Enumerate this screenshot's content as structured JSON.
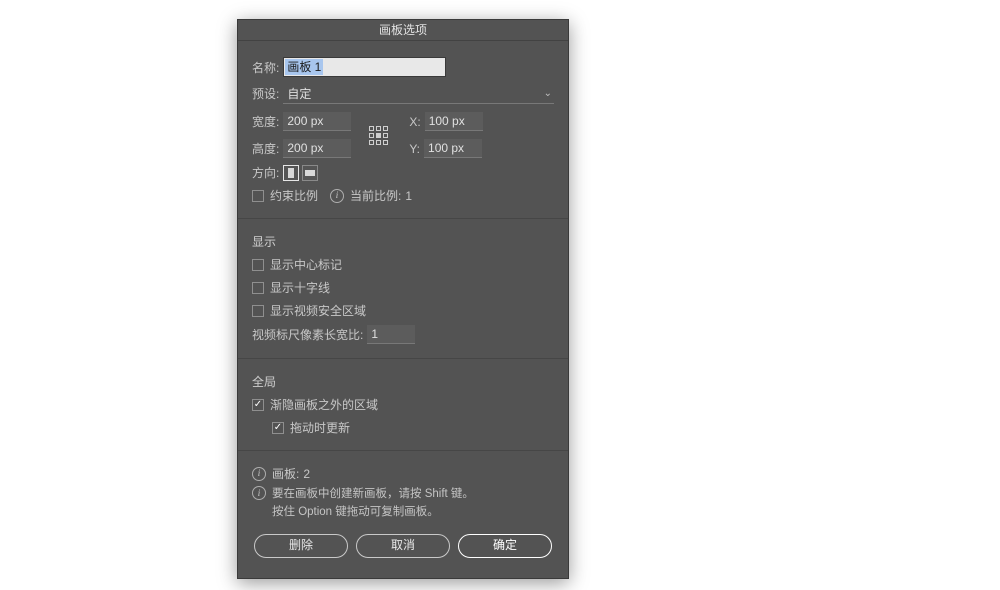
{
  "dialog": {
    "title": "画板选项",
    "name_label": "名称:",
    "name_value": "画板 1",
    "preset_label": "预设:",
    "preset_value": "自定",
    "width_label": "宽度:",
    "width_value": "200 px",
    "height_label": "高度:",
    "height_value": "200 px",
    "x_label": "X:",
    "x_value": "100 px",
    "y_label": "Y:",
    "y_value": "100 px",
    "orientation_label": "方向:",
    "constrain_label": "约束比例",
    "current_ratio_label": "当前比例:",
    "current_ratio_value": "1",
    "display_title": "显示",
    "show_center_label": "显示中心标记",
    "show_cross_label": "显示十字线",
    "show_safe_label": "显示视频安全区域",
    "pixel_aspect_label": "视频标尺像素长宽比:",
    "pixel_aspect_value": "1",
    "global_title": "全局",
    "fade_outside_label": "渐隐画板之外的区域",
    "update_drag_label": "拖动时更新",
    "artboard_count_label": "画板:",
    "artboard_count_value": "2",
    "tip_line1": "要在画板中创建新画板，请按 Shift 键。",
    "tip_line2": "按住 Option 键拖动可复制画板。",
    "btn_delete": "删除",
    "btn_cancel": "取消",
    "btn_ok": "确定"
  }
}
